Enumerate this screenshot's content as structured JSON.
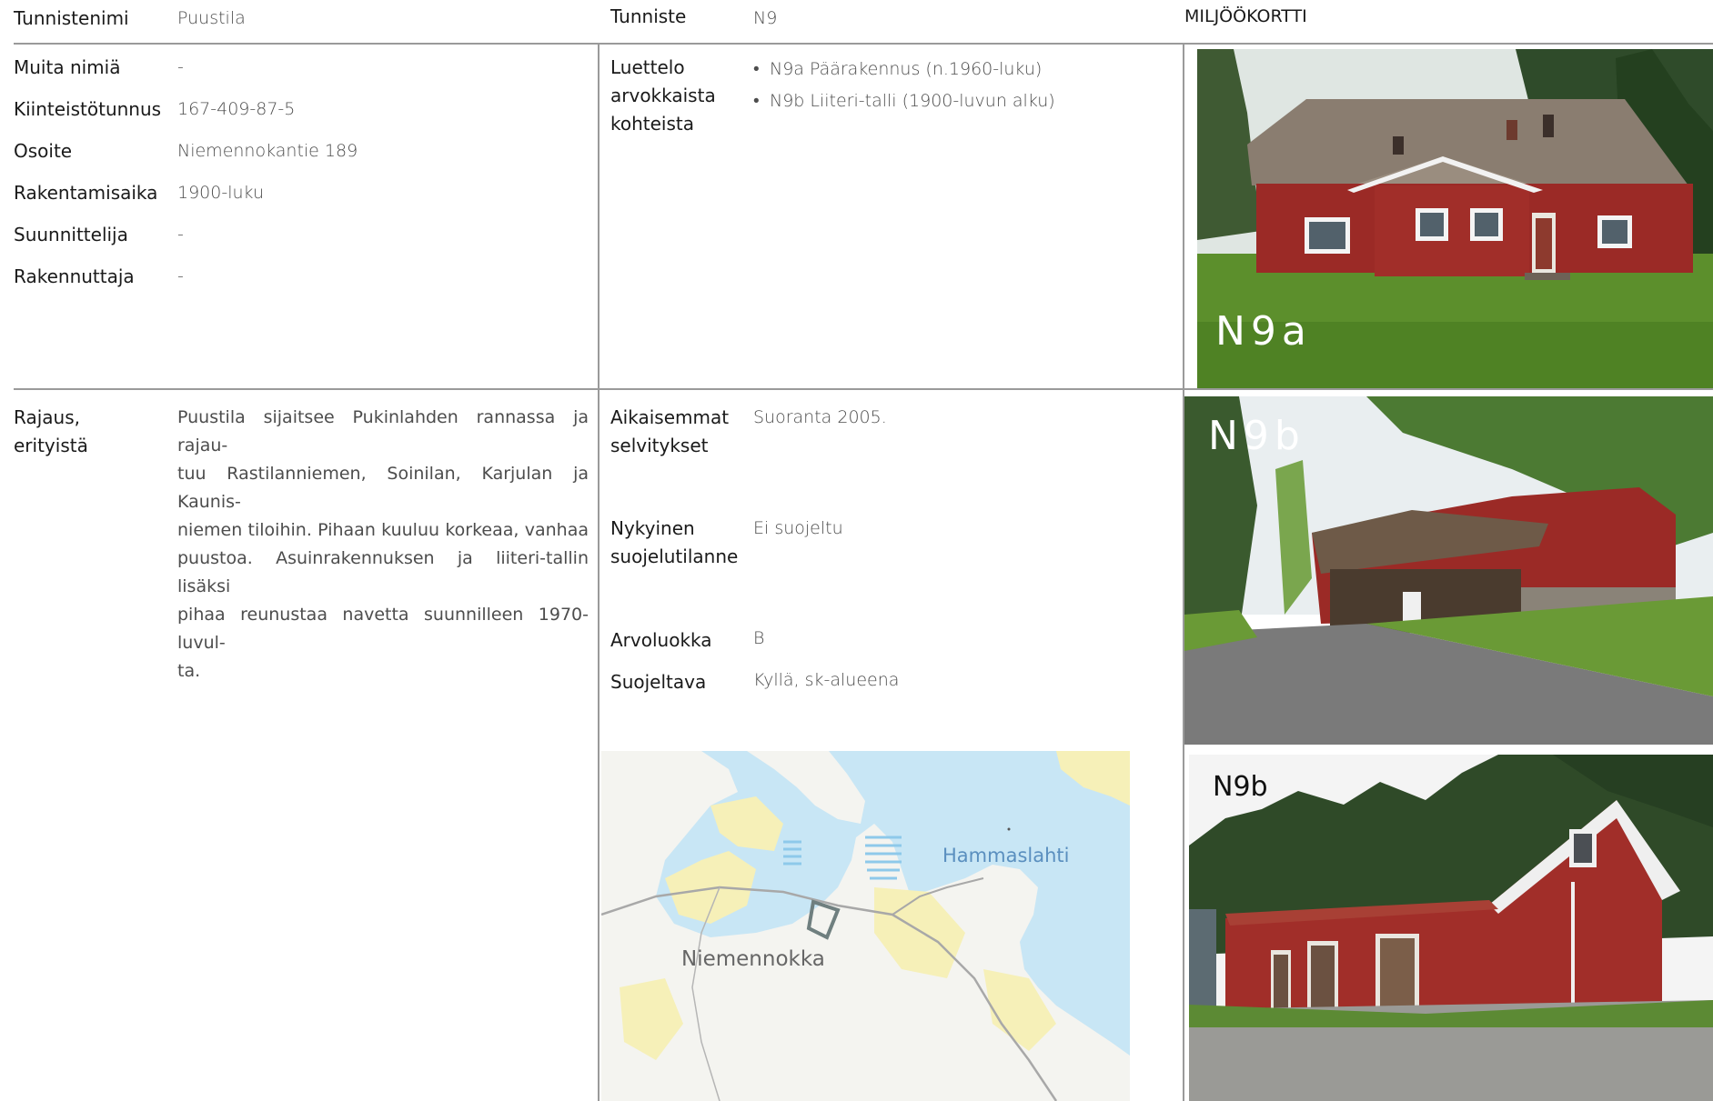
{
  "header": {
    "name_label": "Tunnistenimi",
    "name_value": "Puustila",
    "id_label": "Tunniste",
    "id_value": "N9",
    "card_label": "MILJÖÖKORTTI"
  },
  "info": [
    {
      "label": "Muita nimiä",
      "value": "-"
    },
    {
      "label": "Kiinteistötunnus",
      "value": "167-409-87-5"
    },
    {
      "label": "Osoite",
      "value": "Niemennokantie 189"
    },
    {
      "label": "Rakentamisaika",
      "value": "1900-luku"
    },
    {
      "label": "Suunnittelija",
      "value": "-"
    },
    {
      "label": "Rakennuttaja",
      "value": "-"
    }
  ],
  "objects": {
    "label_lines": [
      "Luettelo",
      "arvokkaista",
      "kohteista"
    ],
    "items": [
      "N9a Päärakennus (n.1960-luku)",
      "N9b Liiteri-talli (1900-luvun alku)"
    ]
  },
  "boundary": {
    "label_lines": [
      "Rajaus,",
      "erityistä"
    ],
    "lines": [
      "Puustila sijaitsee Pukinlahden rannassa ja rajau-",
      "tuu Rastilanniemen, Soinilan, Karjulan ja Kaunis-",
      "niemen tiloihin. Pihaan kuuluu korkeaa, vanhaa",
      "puustoa. Asuinrakennuksen ja liiteri-tallin lisäksi",
      "pihaa reunustaa navetta suunnilleen 1970-luvul-",
      "ta."
    ]
  },
  "prior": {
    "label_lines": [
      "Aikaisemmat",
      "selvitykset"
    ],
    "value": "Suoranta 2005."
  },
  "protection_status": {
    "label_lines": [
      "Nykyinen",
      "suojelutilanne"
    ],
    "value": "Ei suojeltu"
  },
  "value_class": {
    "label": "Arvoluokka",
    "value": "B"
  },
  "protected": {
    "label": "Suojeltava",
    "value": "Kyllä, sk-alueena"
  },
  "map": {
    "label_hammaslahti": "Hammaslahti",
    "label_niemennokka": "Niemennokka"
  },
  "photos": [
    {
      "caption": "N9a"
    },
    {
      "caption": "N9b"
    },
    {
      "caption": "N9b"
    }
  ],
  "colors": {
    "barn_red": "#9b2a26",
    "roof_grey": "#8a7d70",
    "grass": "#5c8f2c",
    "water": "#c8e6f5",
    "land": "#f4f4f0",
    "forest_yellow": "#f6f0b8",
    "map_label_blue": "#5a8fbf"
  }
}
